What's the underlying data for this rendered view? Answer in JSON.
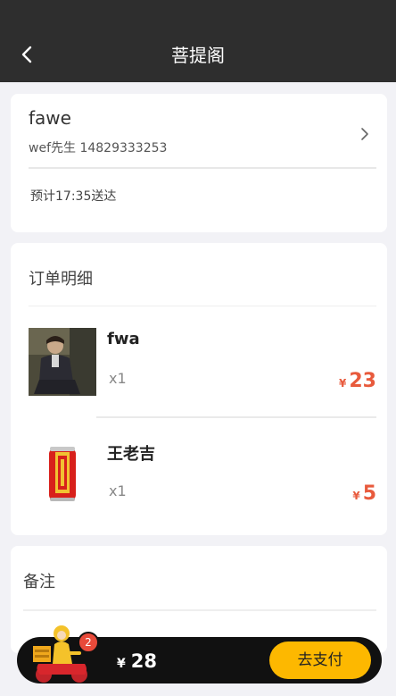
{
  "header": {
    "title": "菩提阁",
    "back_icon": "chevron-left-icon"
  },
  "address": {
    "name": "fawe",
    "contact": "wef先生  14829333253",
    "eta": "预计17:35送达"
  },
  "order": {
    "heading": "订单明细",
    "items": [
      {
        "name": "fwa",
        "qty": "x1",
        "currency": "¥",
        "price": "23",
        "image": "person-photo"
      },
      {
        "name": "王老吉",
        "qty": "x1",
        "currency": "¥",
        "price": "5",
        "image": "red-can"
      }
    ]
  },
  "remark": {
    "heading": "备注"
  },
  "cart": {
    "count": "2",
    "currency": "¥",
    "total": "28",
    "pay_label": "去支付",
    "colors": {
      "bar": "#111111",
      "pay": "#fdb800",
      "badge": "#e84a3a",
      "price": "#e85a3c"
    }
  }
}
